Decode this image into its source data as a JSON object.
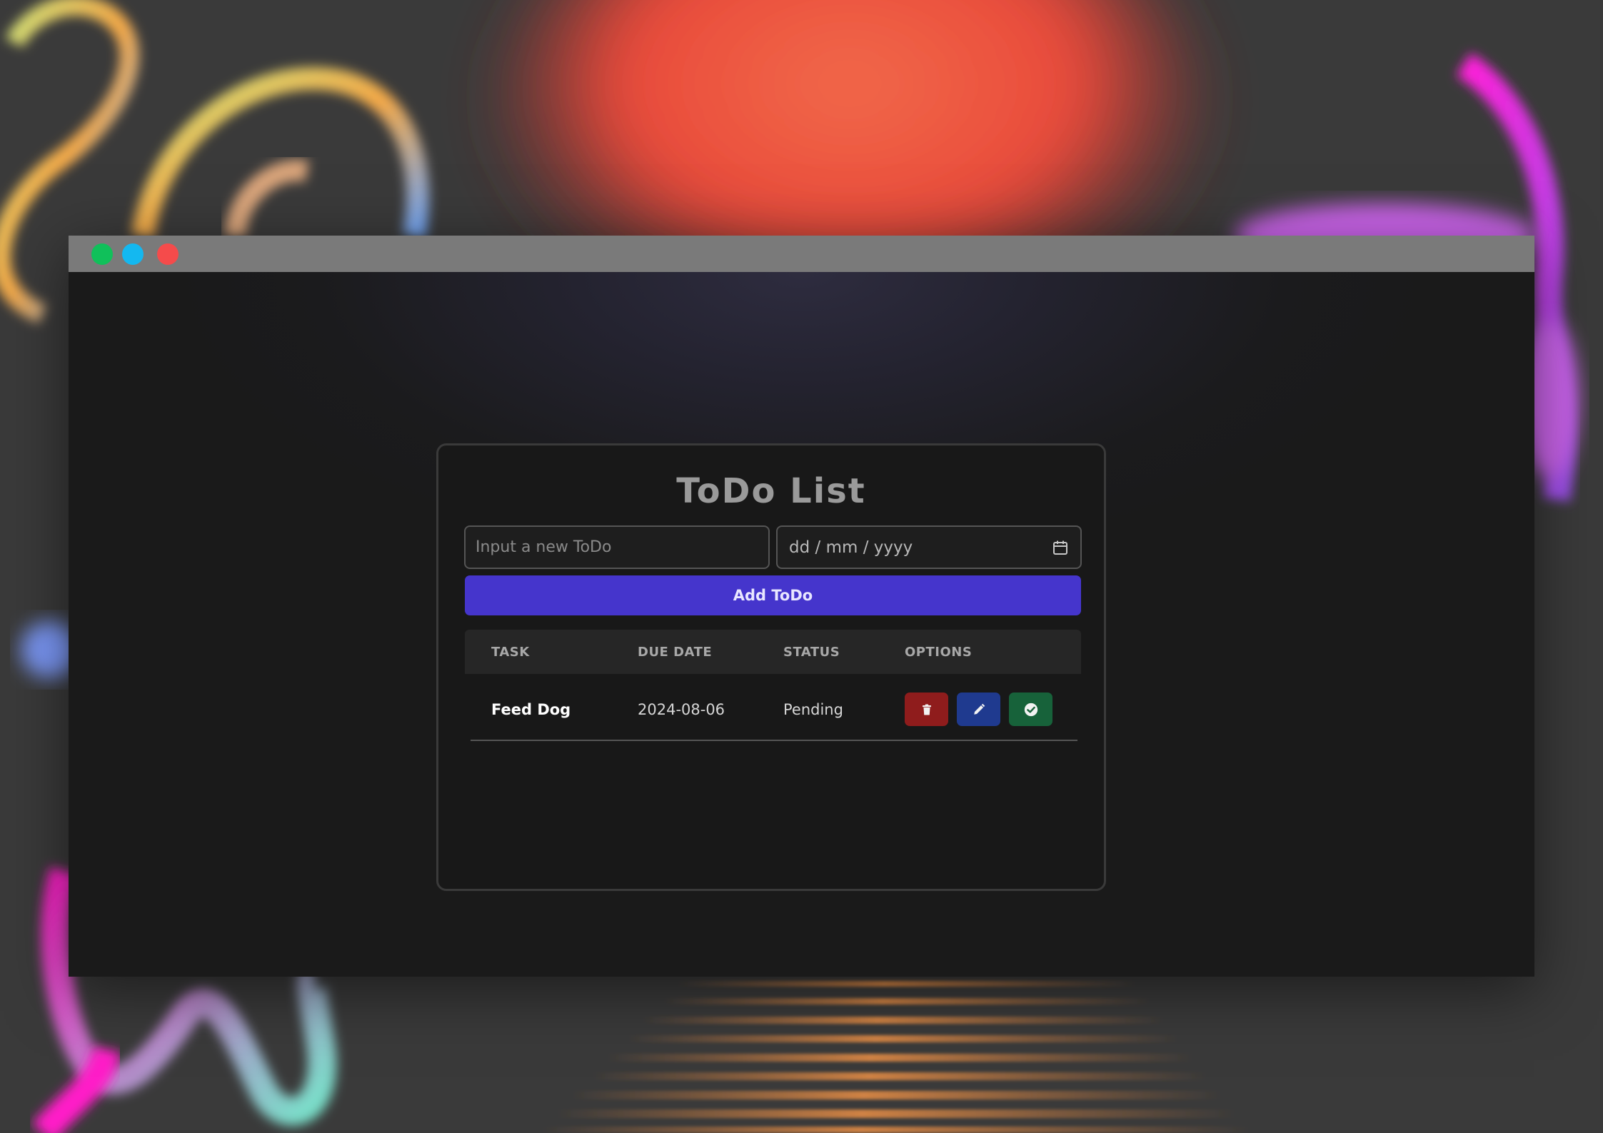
{
  "window": {
    "controls": [
      "green",
      "blue",
      "red"
    ]
  },
  "app": {
    "title": "ToDo List",
    "todo_input": {
      "value": "",
      "placeholder": "Input a new ToDo"
    },
    "date_input": {
      "placeholder": "dd / mm / yyyy",
      "icon": "calendar-icon"
    },
    "add_button_label": "Add ToDo",
    "table": {
      "headers": [
        "TASK",
        "DUE DATE",
        "STATUS",
        "OPTIONS"
      ],
      "rows": [
        {
          "task": "Feed Dog",
          "due_date": "2024-08-06",
          "status": "Pending",
          "options": [
            "trash-icon",
            "pencil-icon",
            "check-circle-icon"
          ]
        }
      ]
    }
  },
  "colors": {
    "accent": "#4535cc",
    "delete": "#8f1c1c",
    "edit": "#1f3a8f",
    "complete": "#17623a",
    "dot_green": "#10c05a",
    "dot_blue": "#14b8f0",
    "dot_red": "#f54b4b"
  }
}
